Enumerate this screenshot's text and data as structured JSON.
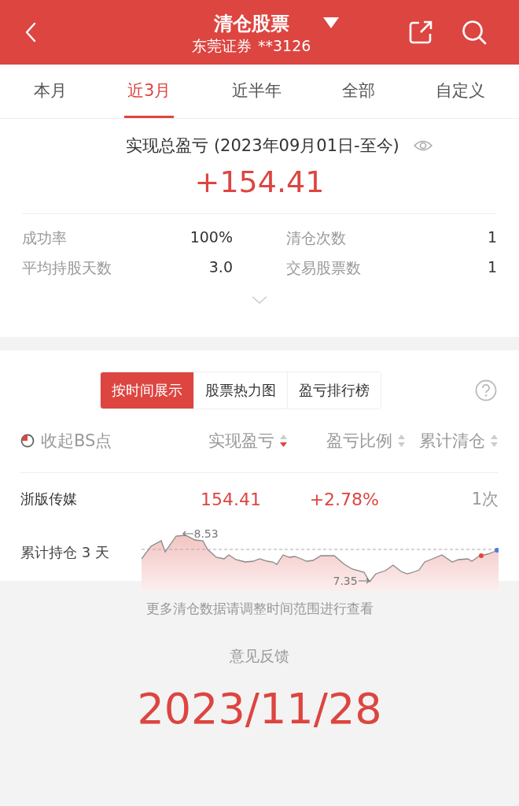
{
  "header": {
    "title": "清仓股票",
    "account": "东莞证券",
    "account_no": "**3126"
  },
  "tabs": [
    {
      "label": "本月",
      "selected": false
    },
    {
      "label": "近3月",
      "selected": true
    },
    {
      "label": "近半年",
      "selected": false
    },
    {
      "label": "全部",
      "selected": false
    },
    {
      "label": "自定义",
      "selected": false
    }
  ],
  "summary": {
    "title": "实现总盈亏 (2023年09月01日-至今)",
    "total": "+154.41",
    "stats": [
      {
        "label": "成功率",
        "value": "100%"
      },
      {
        "label": "清仓次数",
        "value": "1"
      },
      {
        "label": "平均持股天数",
        "value": "3.0"
      },
      {
        "label": "交易股票数",
        "value": "1"
      }
    ]
  },
  "view_tabs": [
    {
      "label": "按时间展示",
      "selected": true
    },
    {
      "label": "股票热力图",
      "selected": false
    },
    {
      "label": "盈亏排行榜",
      "selected": false
    }
  ],
  "bs_toggle": {
    "label": "收起BS点"
  },
  "columns": [
    {
      "label": "实现盈亏",
      "sorted_desc": true
    },
    {
      "label": "盈亏比例",
      "sorted_desc": false
    },
    {
      "label": "累计清仓",
      "sorted_desc": false
    }
  ],
  "rows": [
    {
      "name": "浙版传媒",
      "profit": "154.41",
      "ratio": "+2.78%",
      "count": "1次",
      "holding": "累计持仓 3 天",
      "high_label": "8.53",
      "low_label": "7.35"
    }
  ],
  "footer": {
    "hint": "更多清仓数据请调整时间范围进行查看",
    "feedback": "意见反馈",
    "date": "2023/11/28"
  }
}
